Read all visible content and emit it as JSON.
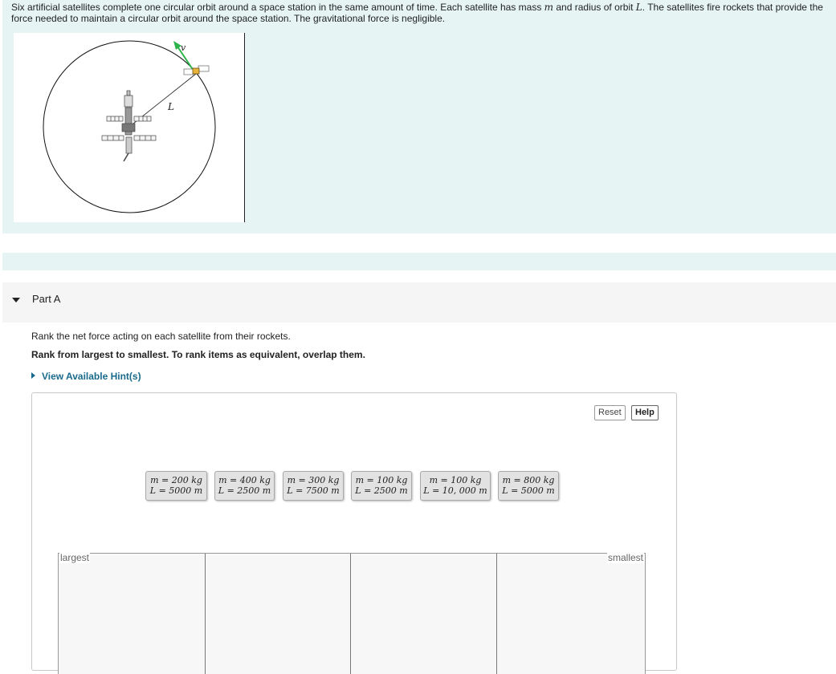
{
  "intro": {
    "text_a": "Six artificial satellites complete one circular orbit around a space station in the same amount of time. Each satellite has mass ",
    "m_symbol": "m",
    "text_b": " and radius of orbit ",
    "L_symbol": "L",
    "text_c": ". The satellites fire rockets that provide the force needed to maintain a circular orbit around the space station. The gravitational force is negligible."
  },
  "figure": {
    "velocity_label": "v",
    "radius_label": "L",
    "velocity_color": "#2db34a"
  },
  "part": {
    "title": "Part A"
  },
  "question": {
    "prompt": "Rank the net force acting on each satellite from their rockets.",
    "instruction": "Rank from largest to smallest. To rank items as equivalent, overlap them.",
    "hint_link": "View Available Hint(s)"
  },
  "controls": {
    "reset": "Reset",
    "help": "Help"
  },
  "tiles": [
    {
      "m": "m = 200 kg",
      "L": "L = 5000 m"
    },
    {
      "m": "m = 400 kg",
      "L": "L = 2500 m"
    },
    {
      "m": "m = 300 kg",
      "L": "L = 7500 m"
    },
    {
      "m": "m = 100 kg",
      "L": "L = 2500 m"
    },
    {
      "m": "m = 100 kg",
      "L": "L = 10, 000 m"
    },
    {
      "m": "m = 800 kg",
      "L": "L = 5000 m"
    }
  ],
  "ranking": {
    "largest_label": "largest",
    "smallest_label": "smallest"
  }
}
